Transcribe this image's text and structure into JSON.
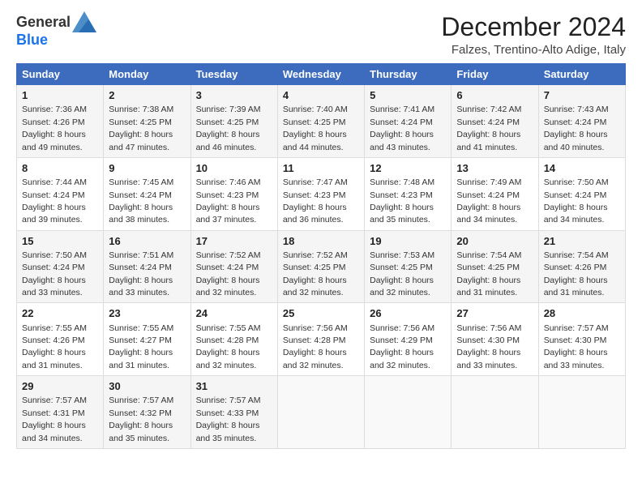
{
  "logo": {
    "text_general": "General",
    "text_blue": "Blue"
  },
  "title": "December 2024",
  "subtitle": "Falzes, Trentino-Alto Adige, Italy",
  "days_of_week": [
    "Sunday",
    "Monday",
    "Tuesday",
    "Wednesday",
    "Thursday",
    "Friday",
    "Saturday"
  ],
  "weeks": [
    [
      {
        "day": "1",
        "sunrise": "7:36 AM",
        "sunset": "4:26 PM",
        "daylight": "8 hours and 49 minutes."
      },
      {
        "day": "2",
        "sunrise": "7:38 AM",
        "sunset": "4:25 PM",
        "daylight": "8 hours and 47 minutes."
      },
      {
        "day": "3",
        "sunrise": "7:39 AM",
        "sunset": "4:25 PM",
        "daylight": "8 hours and 46 minutes."
      },
      {
        "day": "4",
        "sunrise": "7:40 AM",
        "sunset": "4:25 PM",
        "daylight": "8 hours and 44 minutes."
      },
      {
        "day": "5",
        "sunrise": "7:41 AM",
        "sunset": "4:24 PM",
        "daylight": "8 hours and 43 minutes."
      },
      {
        "day": "6",
        "sunrise": "7:42 AM",
        "sunset": "4:24 PM",
        "daylight": "8 hours and 41 minutes."
      },
      {
        "day": "7",
        "sunrise": "7:43 AM",
        "sunset": "4:24 PM",
        "daylight": "8 hours and 40 minutes."
      }
    ],
    [
      {
        "day": "8",
        "sunrise": "7:44 AM",
        "sunset": "4:24 PM",
        "daylight": "8 hours and 39 minutes."
      },
      {
        "day": "9",
        "sunrise": "7:45 AM",
        "sunset": "4:24 PM",
        "daylight": "8 hours and 38 minutes."
      },
      {
        "day": "10",
        "sunrise": "7:46 AM",
        "sunset": "4:23 PM",
        "daylight": "8 hours and 37 minutes."
      },
      {
        "day": "11",
        "sunrise": "7:47 AM",
        "sunset": "4:23 PM",
        "daylight": "8 hours and 36 minutes."
      },
      {
        "day": "12",
        "sunrise": "7:48 AM",
        "sunset": "4:23 PM",
        "daylight": "8 hours and 35 minutes."
      },
      {
        "day": "13",
        "sunrise": "7:49 AM",
        "sunset": "4:24 PM",
        "daylight": "8 hours and 34 minutes."
      },
      {
        "day": "14",
        "sunrise": "7:50 AM",
        "sunset": "4:24 PM",
        "daylight": "8 hours and 34 minutes."
      }
    ],
    [
      {
        "day": "15",
        "sunrise": "7:50 AM",
        "sunset": "4:24 PM",
        "daylight": "8 hours and 33 minutes."
      },
      {
        "day": "16",
        "sunrise": "7:51 AM",
        "sunset": "4:24 PM",
        "daylight": "8 hours and 33 minutes."
      },
      {
        "day": "17",
        "sunrise": "7:52 AM",
        "sunset": "4:24 PM",
        "daylight": "8 hours and 32 minutes."
      },
      {
        "day": "18",
        "sunrise": "7:52 AM",
        "sunset": "4:25 PM",
        "daylight": "8 hours and 32 minutes."
      },
      {
        "day": "19",
        "sunrise": "7:53 AM",
        "sunset": "4:25 PM",
        "daylight": "8 hours and 32 minutes."
      },
      {
        "day": "20",
        "sunrise": "7:54 AM",
        "sunset": "4:25 PM",
        "daylight": "8 hours and 31 minutes."
      },
      {
        "day": "21",
        "sunrise": "7:54 AM",
        "sunset": "4:26 PM",
        "daylight": "8 hours and 31 minutes."
      }
    ],
    [
      {
        "day": "22",
        "sunrise": "7:55 AM",
        "sunset": "4:26 PM",
        "daylight": "8 hours and 31 minutes."
      },
      {
        "day": "23",
        "sunrise": "7:55 AM",
        "sunset": "4:27 PM",
        "daylight": "8 hours and 31 minutes."
      },
      {
        "day": "24",
        "sunrise": "7:55 AM",
        "sunset": "4:28 PM",
        "daylight": "8 hours and 32 minutes."
      },
      {
        "day": "25",
        "sunrise": "7:56 AM",
        "sunset": "4:28 PM",
        "daylight": "8 hours and 32 minutes."
      },
      {
        "day": "26",
        "sunrise": "7:56 AM",
        "sunset": "4:29 PM",
        "daylight": "8 hours and 32 minutes."
      },
      {
        "day": "27",
        "sunrise": "7:56 AM",
        "sunset": "4:30 PM",
        "daylight": "8 hours and 33 minutes."
      },
      {
        "day": "28",
        "sunrise": "7:57 AM",
        "sunset": "4:30 PM",
        "daylight": "8 hours and 33 minutes."
      }
    ],
    [
      {
        "day": "29",
        "sunrise": "7:57 AM",
        "sunset": "4:31 PM",
        "daylight": "8 hours and 34 minutes."
      },
      {
        "day": "30",
        "sunrise": "7:57 AM",
        "sunset": "4:32 PM",
        "daylight": "8 hours and 35 minutes."
      },
      {
        "day": "31",
        "sunrise": "7:57 AM",
        "sunset": "4:33 PM",
        "daylight": "8 hours and 35 minutes."
      },
      null,
      null,
      null,
      null
    ]
  ],
  "labels": {
    "sunrise": "Sunrise:",
    "sunset": "Sunset:",
    "daylight": "Daylight:"
  }
}
